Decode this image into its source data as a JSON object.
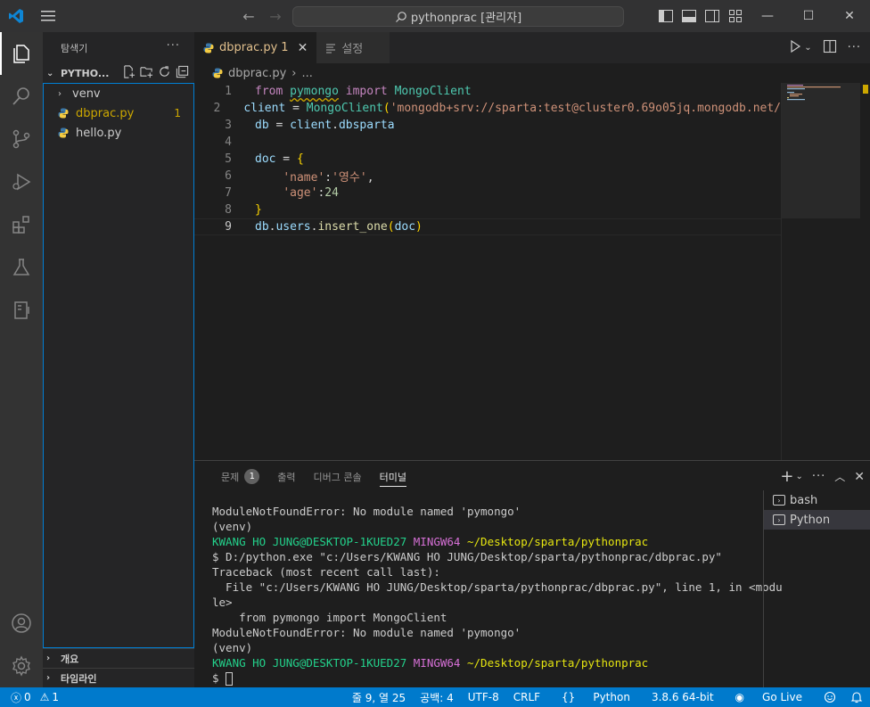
{
  "titlebar": {
    "search_text": "pythonprac [관리자]"
  },
  "sidebar": {
    "title": "탐색기",
    "more": "···",
    "folder": "PYTHO...",
    "tree": [
      {
        "label": "venv",
        "type": "folder",
        "badge": ""
      },
      {
        "label": "dbprac.py",
        "type": "python",
        "badge": "1",
        "color": "#cca700"
      },
      {
        "label": "hello.py",
        "type": "python",
        "badge": "",
        "color": "#cccccc"
      }
    ],
    "outline": "개요",
    "timeline": "타임라인"
  },
  "editor": {
    "tabs": [
      {
        "label": "dbprac.py",
        "badge": "1",
        "active": true
      },
      {
        "label": "설정",
        "active": false
      }
    ],
    "breadcrumb_file": "dbprac.py",
    "breadcrumb_more": "...",
    "line_numbers": [
      "1",
      "2",
      "3",
      "4",
      "5",
      "6",
      "7",
      "8",
      "9"
    ],
    "current_line": 9
  },
  "panel": {
    "tabs": [
      {
        "label": "문제",
        "badge": "1"
      },
      {
        "label": "출력"
      },
      {
        "label": "디버그 콘솔"
      },
      {
        "label": "터미널"
      }
    ],
    "terminal_lines": [
      {
        "type": "plain",
        "text": "ModuleNotFoundError: No module named 'pymongo'"
      },
      {
        "type": "plain",
        "text": "(venv)"
      },
      {
        "type": "prompt",
        "user": "KWANG HO JUNG@DESKTOP-1KUED27",
        "sys": "MINGW64",
        "path": "~/Desktop/sparta/pythonprac"
      },
      {
        "type": "plain",
        "text": "$ D:/python.exe \"c:/Users/KWANG HO JUNG/Desktop/sparta/pythonprac/dbprac.py\""
      },
      {
        "type": "plain",
        "text": "Traceback (most recent call last):"
      },
      {
        "type": "plain",
        "text": "  File \"c:/Users/KWANG HO JUNG/Desktop/sparta/pythonprac/dbprac.py\", line 1, in <modu"
      },
      {
        "type": "plain",
        "text": "le>"
      },
      {
        "type": "plain",
        "text": "    from pymongo import MongoClient"
      },
      {
        "type": "plain",
        "text": "ModuleNotFoundError: No module named 'pymongo'"
      },
      {
        "type": "plain",
        "text": "(venv)"
      },
      {
        "type": "prompt",
        "user": "KWANG HO JUNG@DESKTOP-1KUED27",
        "sys": "MINGW64",
        "path": "~/Desktop/sparta/pythonprac"
      },
      {
        "type": "cursor",
        "text": "$ "
      }
    ],
    "terminals": [
      {
        "label": "bash",
        "active": false
      },
      {
        "label": "Python",
        "active": true
      }
    ]
  },
  "statusbar": {
    "errors": "0",
    "warnings": "1",
    "position": "줄 9, 열 25",
    "spaces": "공백: 4",
    "encoding": "UTF-8",
    "eol": "CRLF",
    "language": "Python",
    "interpreter": "3.8.6 64-bit",
    "live": "Go Live"
  },
  "colors": {
    "accent": "#007acc",
    "warning": "#cca700"
  }
}
